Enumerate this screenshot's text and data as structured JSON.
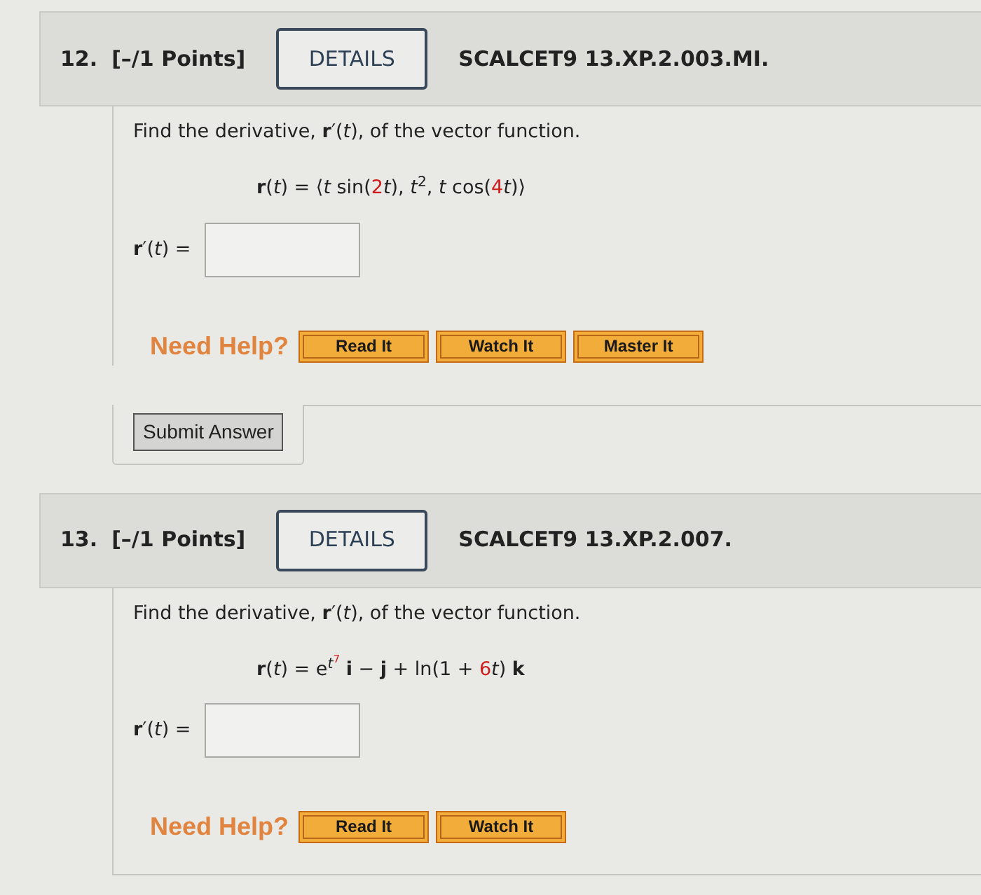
{
  "problems": [
    {
      "number": "12.",
      "points": "[–/1 Points]",
      "details_button": "DETAILS",
      "code": "SCALCET9 13.XP.2.003.MI.",
      "question": "Find the derivative, **r**′(*t*), of the vector function.",
      "equation": [
        {
          "text": "**r**(*t*) = ⟨*t* sin(",
          "highlighted": false
        },
        {
          "text": "2",
          "highlighted": true
        },
        {
          "text": "*t*), *t*$^{2}$, *t* cos(",
          "highlighted": false
        },
        {
          "text": "4",
          "highlighted": true
        },
        {
          "text": "*t*)⟩",
          "highlighted": false
        }
      ],
      "answer_label": "**r**′(*t*) =",
      "help_label": "Need Help?",
      "help_buttons": [
        "Read It",
        "Watch It",
        "Master It"
      ],
      "submit_button": "Submit Answer"
    },
    {
      "number": "13.",
      "points": "[–/1 Points]",
      "details_button": "DETAILS",
      "code": "SCALCET9 13.XP.2.007.",
      "question": "Find the derivative, **r**′(*t*), of the vector function.",
      "equation": [
        {
          "text": "**r**(*t*) = e",
          "highlighted": false,
          "exponent": [
            {
              "text": "*t*",
              "highlighted": false,
              "exponent": [
                {
                  "text": "7",
                  "highlighted": true
                }
              ]
            }
          ]
        },
        {
          "text": " **i** − **j** + ln(1 + ",
          "highlighted": false
        },
        {
          "text": "6",
          "highlighted": true
        },
        {
          "text": "*t*) **k**",
          "highlighted": false
        }
      ],
      "answer_label": "**r**′(*t*) =",
      "help_label": "Need Help?",
      "help_buttons": [
        "Read It",
        "Watch It"
      ]
    }
  ]
}
